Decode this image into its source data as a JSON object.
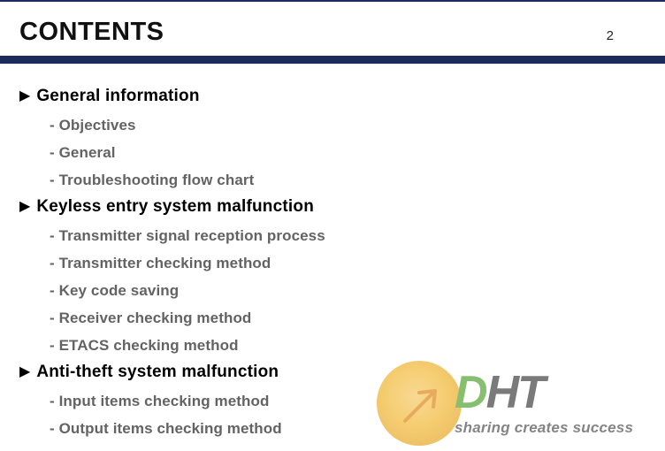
{
  "header": {
    "title": "CONTENTS",
    "page_number": "2"
  },
  "sections": [
    {
      "title": "General information",
      "items": [
        "Objectives",
        "General",
        "Troubleshooting flow chart"
      ]
    },
    {
      "title": "Keyless entry system malfunction",
      "items": [
        "Transmitter signal reception process",
        "Transmitter checking method",
        "Key code saving",
        "Receiver checking method",
        "ETACS checking method"
      ]
    },
    {
      "title": "Anti-theft system malfunction",
      "items": [
        "Input items checking method",
        "Output items checking method"
      ]
    }
  ],
  "watermark": {
    "brand_d": "D",
    "brand_h": "H",
    "brand_t": "T",
    "tagline": "sharing creates success"
  }
}
